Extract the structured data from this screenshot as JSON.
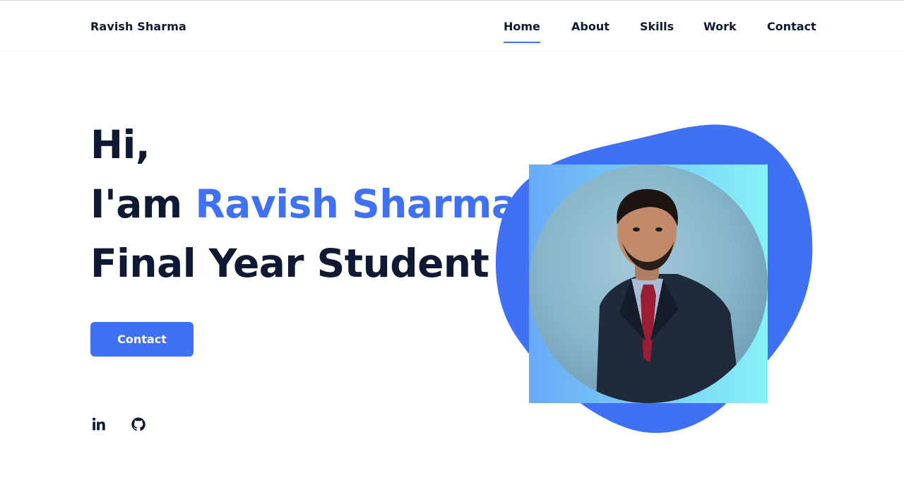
{
  "header": {
    "logo": "Ravish Sharma",
    "nav": [
      {
        "label": "Home",
        "active": true
      },
      {
        "label": "About",
        "active": false
      },
      {
        "label": "Skills",
        "active": false
      },
      {
        "label": "Work",
        "active": false
      },
      {
        "label": "Contact",
        "active": false
      }
    ]
  },
  "hero": {
    "greeting": "Hi,",
    "intro_prefix": "I'am ",
    "name": "Ravish Sharma",
    "role": "Final Year Student",
    "cta_label": "Contact"
  },
  "social": [
    {
      "icon": "linkedin-icon"
    },
    {
      "icon": "github-icon"
    }
  ],
  "colors": {
    "accent": "#4070f4",
    "text": "#0e1a33",
    "blob": "#4070f4",
    "photo_gradient": [
      "#69aaf7",
      "#86f1f7"
    ]
  }
}
